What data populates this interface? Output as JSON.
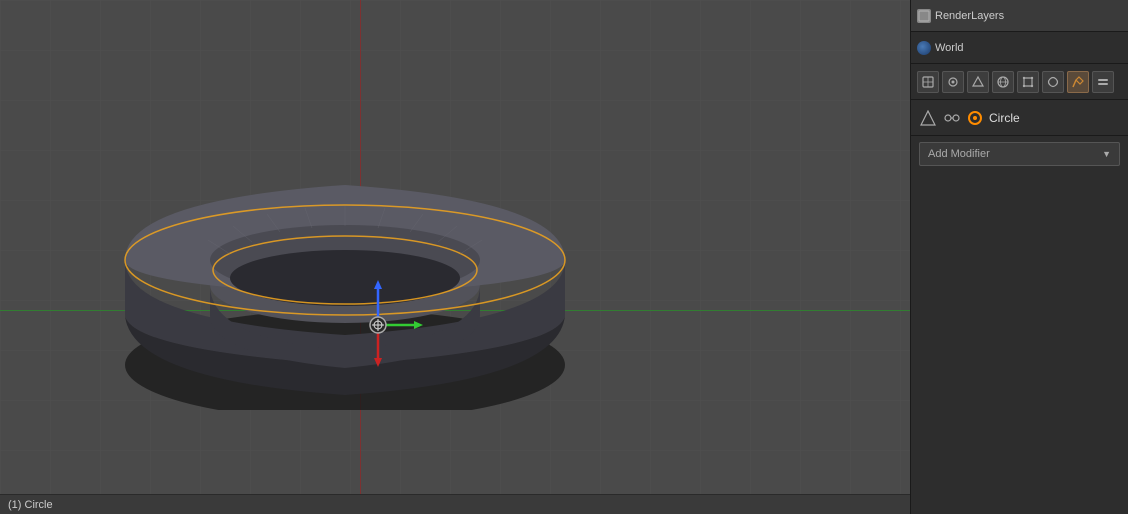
{
  "viewport": {
    "background_color": "#4a4a4a",
    "grid_color": "#555555"
  },
  "status_bar": {
    "text": "(1) Circle"
  },
  "right_panel": {
    "render_layers_label": "RenderLayers",
    "world_label": "World",
    "object_name": "Circle",
    "add_modifier_label": "Add Modifier",
    "toolbar_icons": [
      "mesh-icon",
      "curve-icon",
      "surface-icon",
      "meta-icon",
      "armature-icon",
      "camera-icon",
      "lamp-icon",
      "settings-icon"
    ],
    "prop_icons": [
      "transform-icon",
      "relations-icon"
    ]
  }
}
